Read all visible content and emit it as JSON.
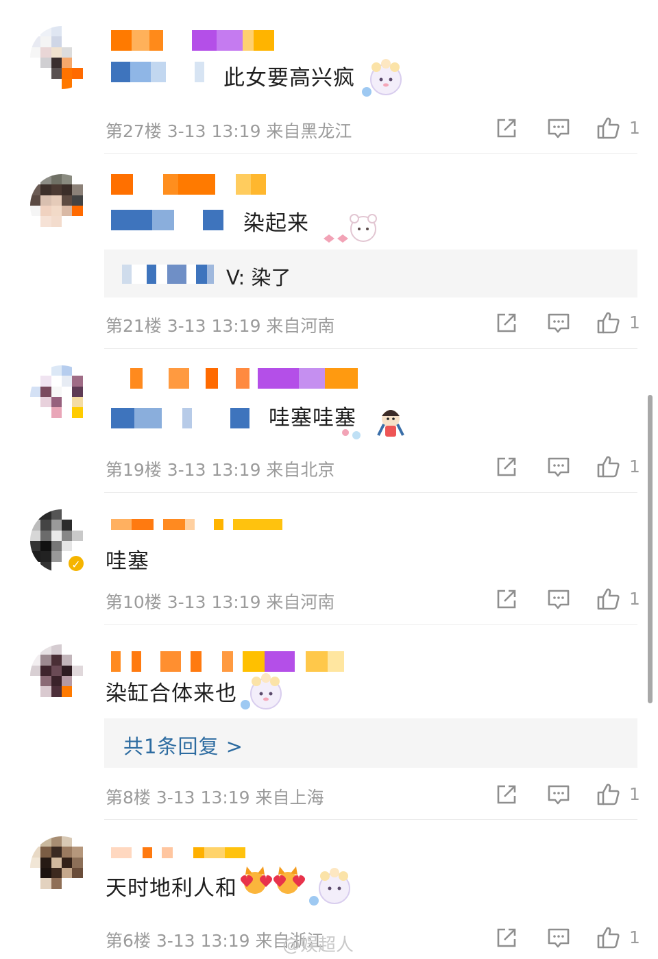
{
  "comments": [
    {
      "text": "此女要高兴疯",
      "meta": "第27楼 3-13 13:19 来自黑龙江",
      "like_count": "1",
      "has_sticker": true
    },
    {
      "text": "染起来",
      "quote_text": "V: 染了",
      "meta": "第21楼 3-13 13:19 来自河南",
      "like_count": "1",
      "has_sticker": true
    },
    {
      "text": "哇塞哇塞",
      "meta": "第19楼 3-13 13:19 来自北京",
      "like_count": "1",
      "has_sticker": true
    },
    {
      "text": "哇塞",
      "meta": "第10楼 3-13 13:19 来自河南",
      "like_count": "1",
      "verified": true
    },
    {
      "text": "染缸合体来也",
      "reply_link": "共1条回复 >",
      "meta": "第8楼 3-13 13:19 来自上海",
      "like_count": "1",
      "has_sticker": true
    },
    {
      "text": "天时地利人和",
      "meta": "第6楼 3-13 13:19 来自浙江",
      "like_count": "1",
      "has_sticker": true
    }
  ],
  "watermark": "@娱超人",
  "icons": {
    "share": "share-icon",
    "comment": "comment-icon",
    "like": "thumbs-up-icon",
    "verified": "verified-badge-icon"
  },
  "colors": {
    "meta_gray": "#9b9b9b",
    "link_blue": "#2c6ba0",
    "quote_bg": "#f5f5f5",
    "divider": "#ececec"
  }
}
